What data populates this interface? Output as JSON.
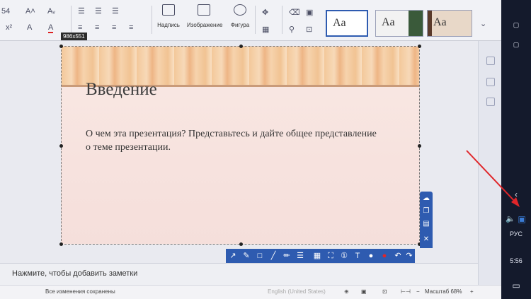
{
  "ribbon": {
    "font_size_fragment": "54",
    "insert_textbox_label": "Надпись",
    "insert_image_label": "Изображение",
    "insert_shape_label": "Фигура",
    "theme_sample_label": "Aa"
  },
  "slide": {
    "size_label": "986x551",
    "title": "Введение",
    "body": "О чем эта презентация? Представьтесь и дайте общее представление о теме презентации."
  },
  "notes": {
    "placeholder": "Нажмите, чтобы добавить заметки"
  },
  "status": {
    "saved": "Все изменения сохранены",
    "language": "English (United States)",
    "zoom": "Масштаб 68%",
    "zoom_percent": 68
  },
  "taskbar": {
    "language": "РУС",
    "time": "5:56"
  },
  "colors": {
    "accent": "#2e5bb0",
    "arrow": "#e0262a",
    "taskbar": "#141a2c"
  }
}
